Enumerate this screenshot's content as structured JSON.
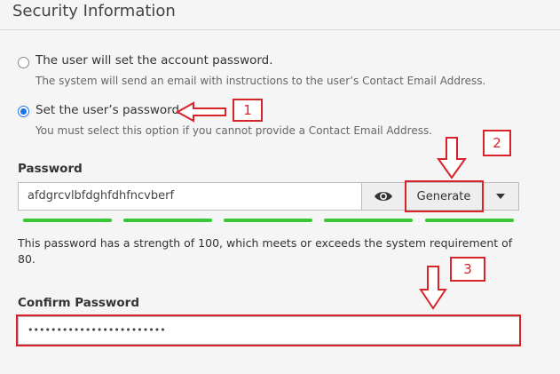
{
  "section": {
    "title": "Security Information"
  },
  "options": [
    {
      "label": "The user will set the account password.",
      "help": "The system will send an email with instructions to the user’s Contact Email Address.",
      "checked": false
    },
    {
      "label": "Set the user’s password.",
      "help": "You must select this option if you cannot provide a Contact Email Address.",
      "checked": true
    }
  ],
  "password": {
    "label": "Password",
    "value": "afdgrcvlbfdghfdhfncvberf",
    "toggle_icon": "eye-icon",
    "generate_label": "Generate",
    "dropdown_icon": "caret-down-icon"
  },
  "strength": {
    "score": 100,
    "required": 80,
    "segments_filled": 5,
    "segments_total": 5,
    "color": "#36c935",
    "text": "This password has a strength of 100, which meets or exceeds the system requirement of 80."
  },
  "confirm": {
    "label": "Confirm Password",
    "value": "••••••••••••••••••••••••"
  },
  "annotations": {
    "color": "#d8232a",
    "markers": [
      "1",
      "2",
      "3"
    ]
  }
}
